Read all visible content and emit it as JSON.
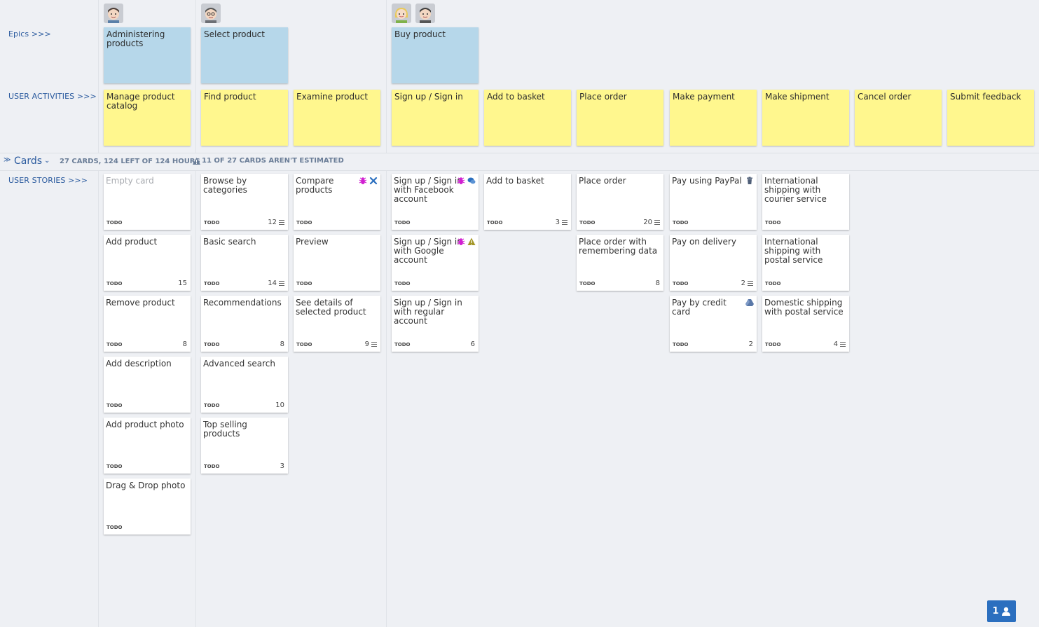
{
  "labels": {
    "epics": "Epics >>>",
    "activities": "USER ACTIVITIES >>>",
    "stories": "USER STORIES >>>"
  },
  "epics": [
    {
      "title": "Administering products"
    },
    {
      "title": "Select product"
    },
    {
      "title": "Buy product"
    }
  ],
  "activities": [
    {
      "title": "Manage product catalog"
    },
    {
      "title": "Find product"
    },
    {
      "title": "Examine product"
    },
    {
      "title": "Sign up / Sign in"
    },
    {
      "title": "Add to basket"
    },
    {
      "title": "Place order"
    },
    {
      "title": "Make payment"
    },
    {
      "title": "Make shipment"
    },
    {
      "title": "Cancel order"
    },
    {
      "title": "Submit feedback"
    }
  ],
  "cards_section": {
    "title": "Cards",
    "summary": "27 CARDS, 124 LEFT OF 124 HOURS",
    "warning": "11 OF 27 CARDS AREN'T ESTIMATED"
  },
  "stories": {
    "c1": [
      {
        "title": "Empty card",
        "status": "TODO",
        "estimate": ""
      },
      {
        "title": "Add product",
        "status": "TODO",
        "estimate": "15"
      },
      {
        "title": "Remove product",
        "status": "TODO",
        "estimate": "8"
      },
      {
        "title": "Add description",
        "status": "TODO",
        "estimate": ""
      },
      {
        "title": "Add product photo",
        "status": "TODO",
        "estimate": ""
      },
      {
        "title": "Drag & Drop photo",
        "status": "TODO",
        "estimate": ""
      }
    ],
    "c2": [
      {
        "title": "Browse by categories",
        "status": "TODO",
        "estimate": "12"
      },
      {
        "title": "Basic search",
        "status": "TODO",
        "estimate": "14"
      },
      {
        "title": "Recommendations",
        "status": "TODO",
        "estimate": "8"
      },
      {
        "title": "Advanced search",
        "status": "TODO",
        "estimate": "10"
      },
      {
        "title": "Top selling products",
        "status": "TODO",
        "estimate": "3"
      }
    ],
    "c3": [
      {
        "title": "Compare products",
        "status": "TODO",
        "estimate": ""
      },
      {
        "title": "Preview",
        "status": "TODO",
        "estimate": ""
      },
      {
        "title": "See details of selected product",
        "status": "TODO",
        "estimate": "9"
      }
    ],
    "c4": [
      {
        "title": "Sign up / Sign in with Facebook account",
        "status": "TODO",
        "estimate": ""
      },
      {
        "title": "Sign up / Sign in with Google account",
        "status": "TODO",
        "estimate": ""
      },
      {
        "title": "Sign up / Sign in with regular account",
        "status": "TODO",
        "estimate": "6"
      }
    ],
    "c5": [
      {
        "title": "Add to basket",
        "status": "TODO",
        "estimate": "3"
      }
    ],
    "c6": [
      {
        "title": "Place order",
        "status": "TODO",
        "estimate": "20"
      },
      {
        "title": "Place order with remembering data",
        "status": "TODO",
        "estimate": "8"
      }
    ],
    "c7": [
      {
        "title": "Pay using PayPal",
        "status": "TODO",
        "estimate": ""
      },
      {
        "title": "Pay on delivery",
        "status": "TODO",
        "estimate": "2"
      },
      {
        "title": "Pay by credit card",
        "status": "TODO",
        "estimate": "2"
      }
    ],
    "c8": [
      {
        "title": "International shipping with courier service",
        "status": "TODO",
        "estimate": ""
      },
      {
        "title": "International shipping with postal service",
        "status": "TODO",
        "estimate": ""
      },
      {
        "title": "Domestic shipping with postal service",
        "status": "TODO",
        "estimate": "4"
      }
    ]
  },
  "users_button": {
    "count": "1"
  },
  "icon_names": [
    "person-avatar-icon",
    "bug-icon",
    "tools-icon",
    "comments-icon",
    "warning-icon",
    "trash-icon",
    "drive-icon",
    "description-lines-icon",
    "user-icon",
    "collapse-icon",
    "chevron-down-icon"
  ]
}
